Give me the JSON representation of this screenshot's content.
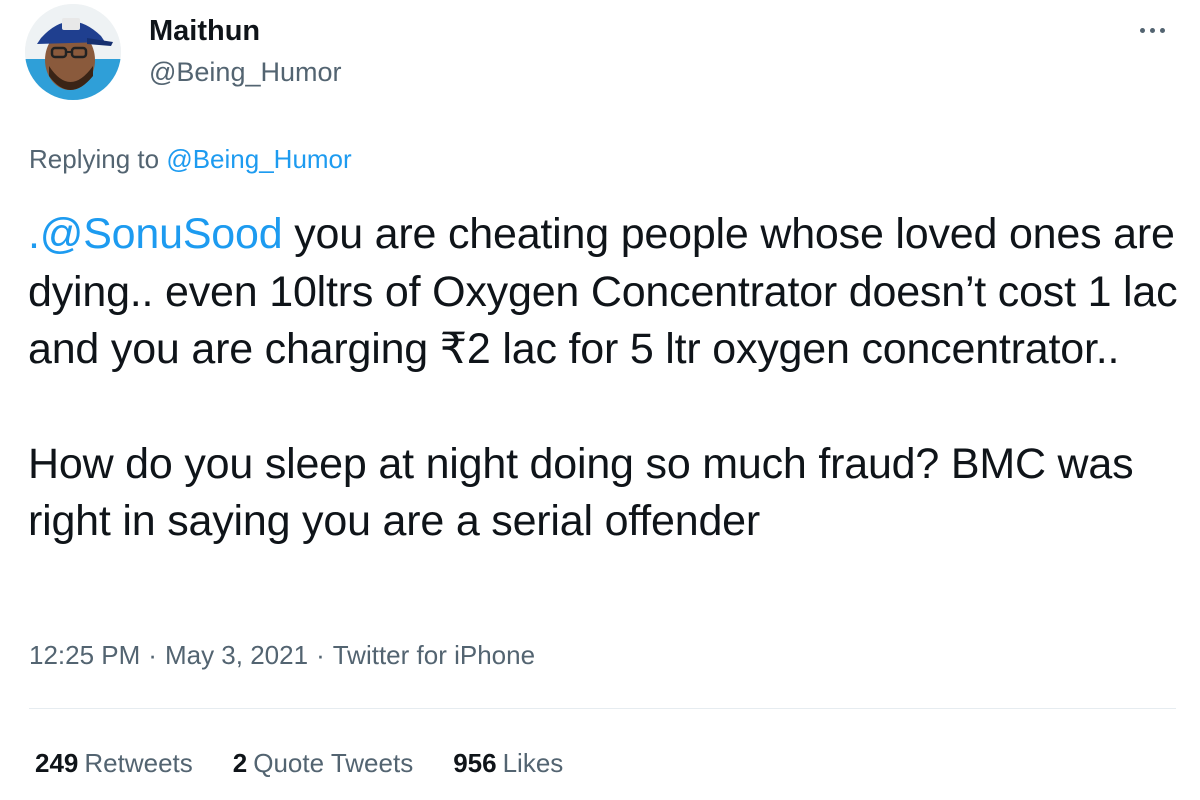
{
  "author": {
    "display_name": "Maithun",
    "handle": "@Being_Humor"
  },
  "menu": {
    "icon": "more-horizontal-icon"
  },
  "reply_context": {
    "prefix": "Replying to",
    "mention": "@Being_Humor"
  },
  "tweet": {
    "mention": ".@SonuSood",
    "paragraph1_rest": " you are cheating people whose loved ones are dying.. even 10ltrs of Oxygen Concentrator doesn’t cost 1 lac and you are charging ₹2 lac for 5 ltr oxygen concentrator..",
    "paragraph2": "How do you sleep at night doing so much fraud? BMC was right in saying you are a serial offender"
  },
  "meta": {
    "time": "12:25 PM",
    "date": "May 3, 2021",
    "source": "Twitter for iPhone",
    "separator": "·"
  },
  "stats": {
    "retweets_count": "249",
    "retweets_label": "Retweets",
    "quotes_count": "2",
    "quotes_label": "Quote Tweets",
    "likes_count": "956",
    "likes_label": "Likes"
  },
  "colors": {
    "link": "#1d9bf0",
    "secondary_text": "#536471",
    "primary_text": "#0f1419"
  }
}
